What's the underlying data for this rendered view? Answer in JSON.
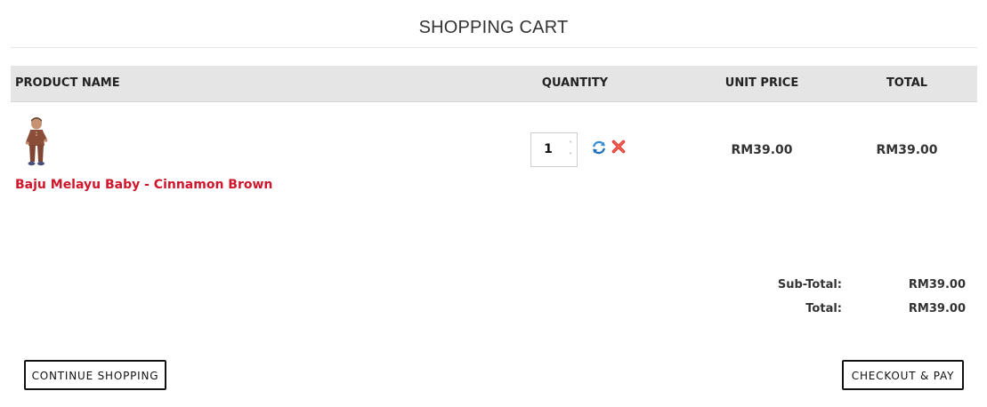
{
  "page": {
    "title": "SHOPPING CART"
  },
  "table": {
    "columns": [
      "PRODUCT NAME",
      "QUANTITY",
      "UNIT PRICE",
      "TOTAL"
    ]
  },
  "items": [
    {
      "name": "Baju Melayu Baby - Cinnamon Brown",
      "quantity": "1",
      "unit_price": "RM39.00",
      "total": "RM39.00",
      "thumbnail_icon": "baby-outfit-photo"
    }
  ],
  "icons": {
    "spin_up": "˄",
    "spin_down": "˅",
    "refresh": "refresh-icon",
    "remove": "remove-icon"
  },
  "summary": {
    "subtotal_label": "Sub-Total:",
    "subtotal_value": "RM39.00",
    "total_label": "Total:",
    "total_value": "RM39.00"
  },
  "actions": {
    "continue_label": "CONTINUE SHOPPING",
    "checkout_label": "CHECKOUT & PAY"
  },
  "colors": {
    "accent_red": "#d0162b",
    "header_bg": "#e5e5e5",
    "refresh_blue": "#3a8fd6"
  }
}
